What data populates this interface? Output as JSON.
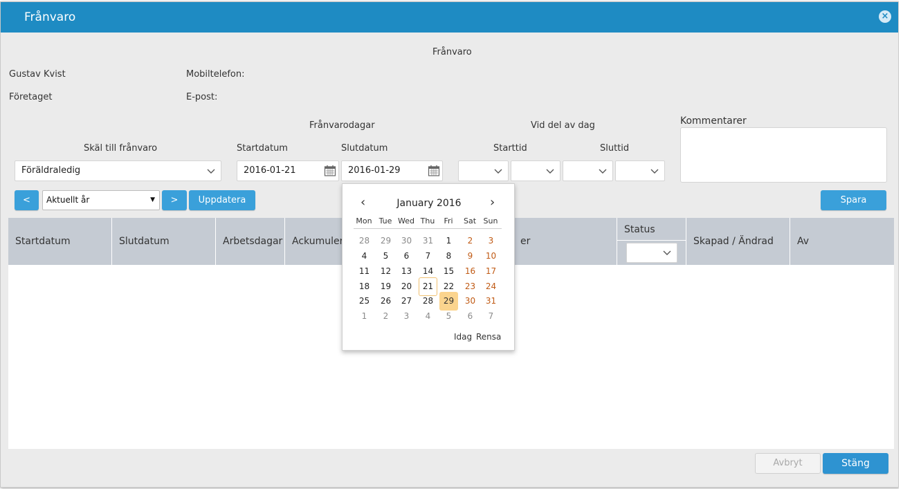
{
  "dialog": {
    "title": "Frånvaro",
    "close_icon": "×"
  },
  "info": {
    "heading": "Frånvaro",
    "name": "Gustav Kvist",
    "company": "Företaget",
    "mobile_label": "Mobiltelefon:",
    "email_label": "E-post:"
  },
  "form": {
    "franvarodagar_label": "Frånvarodagar",
    "vid_del_label": "Vid del av dag",
    "kommentarer_label": "Kommentarer",
    "skal_label": "Skäl till frånvaro",
    "skal_value": "Föräldraledig",
    "startdatum_label": "Startdatum",
    "startdatum_value": "2016-01-21",
    "slutdatum_label": "Slutdatum",
    "slutdatum_value": "2016-01-29",
    "starttid_label": "Starttid",
    "sluttid_label": "Sluttid"
  },
  "toolbar": {
    "prev_label": "<",
    "next_label": ">",
    "year_value": "Aktuellt år",
    "update_label": "Uppdatera",
    "save_label": "Spara"
  },
  "table": {
    "headers": [
      "Startdatum",
      "Slutdatum",
      "Arbetsdagar",
      "Ackumulera",
      "er",
      "Status",
      "Skapad / Ändrad",
      "Av"
    ]
  },
  "datepicker": {
    "month_title": "January 2016",
    "prev_icon": "‹",
    "next_icon": "›",
    "weekdays": [
      "Mon",
      "Tue",
      "Wed",
      "Thu",
      "Fri",
      "Sat",
      "Sun"
    ],
    "weeks": [
      [
        "28",
        "29",
        "30",
        "31",
        "1",
        "2",
        "3"
      ],
      [
        "4",
        "5",
        "6",
        "7",
        "8",
        "9",
        "10"
      ],
      [
        "11",
        "12",
        "13",
        "14",
        "15",
        "16",
        "17"
      ],
      [
        "18",
        "19",
        "20",
        "21",
        "22",
        "23",
        "24"
      ],
      [
        "25",
        "26",
        "27",
        "28",
        "29",
        "30",
        "31"
      ],
      [
        "1",
        "2",
        "3",
        "4",
        "5",
        "6",
        "7"
      ]
    ],
    "today_label": "Idag",
    "clear_label": "Rensa"
  },
  "footer": {
    "cancel_label": "Avbryt",
    "close_label": "Stäng"
  },
  "colors": {
    "titlebar": "#1e8bc3",
    "button": "#3aa0da",
    "weekend": "#c05a14",
    "selected_day": "#fbd48e",
    "table_header": "#c5cbd3"
  }
}
